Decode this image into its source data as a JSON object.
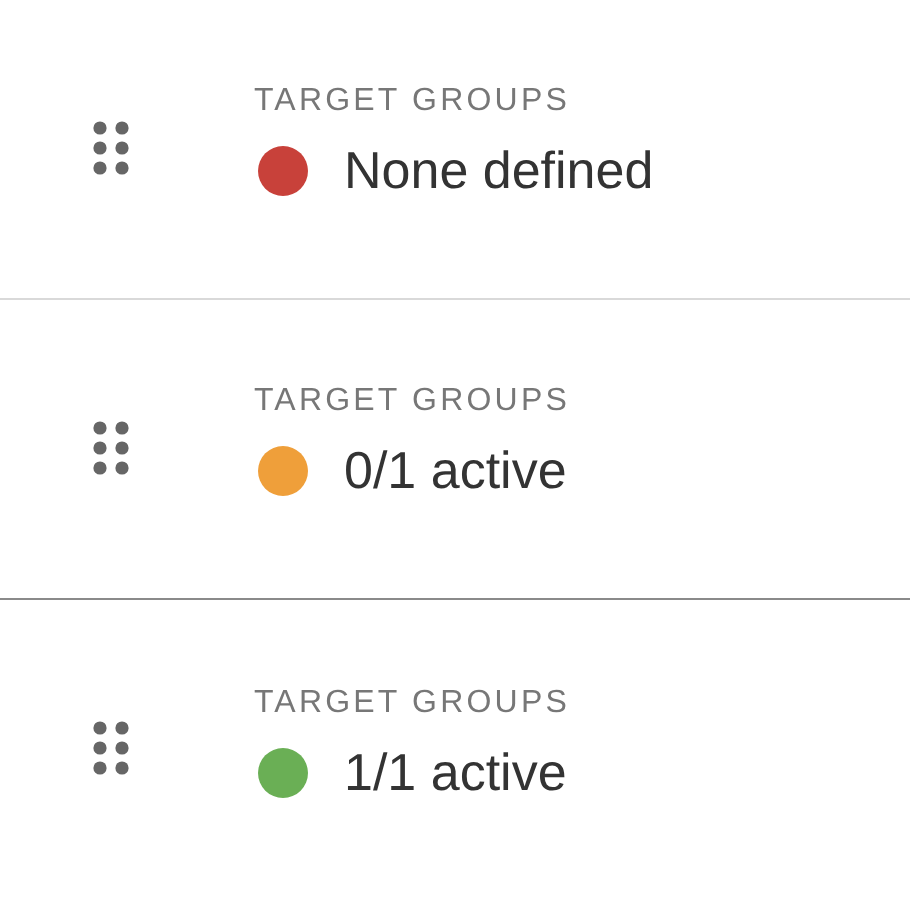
{
  "items": [
    {
      "label": "TARGET GROUPS",
      "status": "None defined",
      "color": "#c8413a"
    },
    {
      "label": "TARGET GROUPS",
      "status": "0/1 active",
      "color": "#ef9f3a"
    },
    {
      "label": "TARGET GROUPS",
      "status": "1/1 active",
      "color": "#6aaf55"
    }
  ]
}
